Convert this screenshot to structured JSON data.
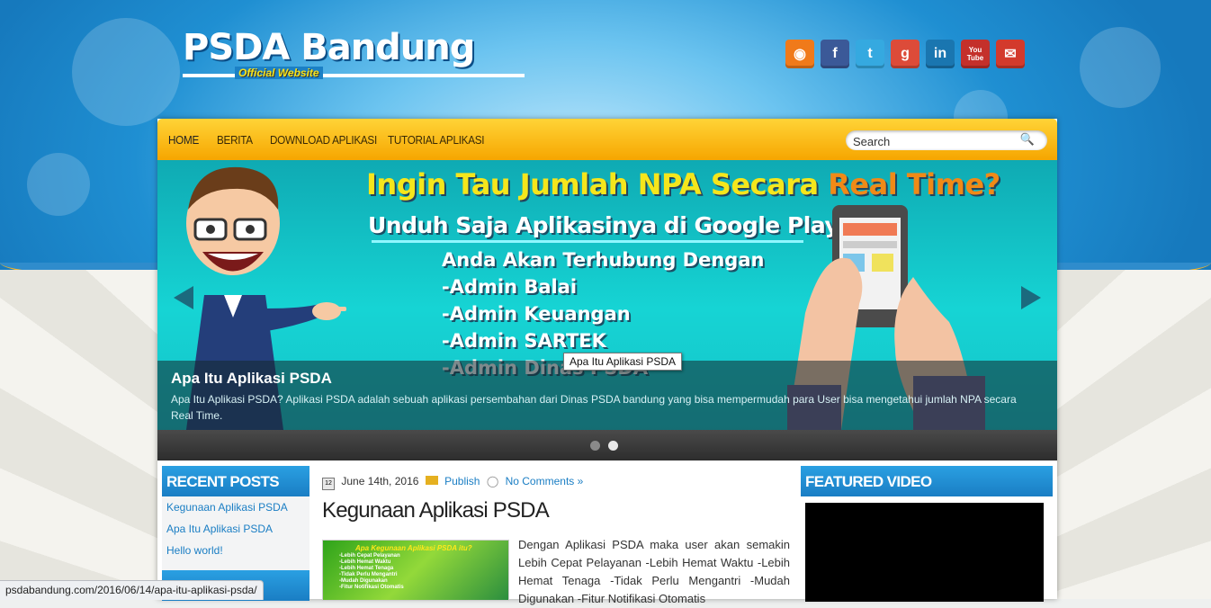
{
  "site": {
    "title": "PSDA Bandung",
    "subtitle": "Official Website"
  },
  "social": [
    {
      "name": "rss-icon",
      "glyph": "◉",
      "color": "#f07a1a"
    },
    {
      "name": "facebook-icon",
      "glyph": "f",
      "color": "#3b5998"
    },
    {
      "name": "twitter-icon",
      "glyph": "t",
      "color": "#35a9e0"
    },
    {
      "name": "google-icon",
      "glyph": "g",
      "color": "#dd4b39"
    },
    {
      "name": "linkedin-icon",
      "glyph": "in",
      "color": "#1a76b0"
    },
    {
      "name": "youtube-icon",
      "glyph": "You Tube",
      "color": "#c4302b"
    },
    {
      "name": "email-icon",
      "glyph": "✉",
      "color": "#d33a2c"
    }
  ],
  "nav": {
    "items": [
      "HOME",
      "BERITA",
      "DOWNLOAD APLIKASI",
      "TUTORIAL APLIKASI"
    ],
    "search_value": "Search"
  },
  "slider": {
    "headline_part1": "Ingin Tau Jumlah NPA Secara ",
    "headline_part2": "Real Time?",
    "subhead": "Unduh Saja Aplikasinya di Google Play",
    "list": [
      "Anda Akan Terhubung Dengan",
      "-Admin Balai",
      "-Admin Keuangan",
      "-Admin SARTEK",
      "-Admin Dinas PSDA"
    ],
    "caption_title": "Apa Itu Aplikasi PSDA",
    "caption_text": "Apa Itu Aplikasi PSDA? Aplikasi PSDA adalah sebuah aplikasi persembahan dari Dinas PSDA bandung yang bisa mempermudah para User bisa mengetahui jumlah NPA secara Real Time.",
    "tooltip": "Apa Itu Aplikasi PSDA",
    "active_dot": 2,
    "dot_count": 2
  },
  "recent_posts": {
    "title": "RECENT POSTS",
    "items": [
      "Kegunaan Aplikasi PSDA",
      "Apa Itu Aplikasi PSDA",
      "Hello world!"
    ]
  },
  "post": {
    "date": "June 14th, 2016",
    "category": "Publish",
    "comments": "No Comments »",
    "title": "Kegunaan Aplikasi PSDA",
    "thumb_title": "Apa Kegunaan Aplikasi PSDA itu?",
    "thumb_items": [
      "-Lebih Cepat Pelayanan",
      "-Lebih Hemat Waktu",
      "-Lebih Hemat Tenaga",
      "-Tidak Perlu Mengantri",
      "-Mudah Digunakan",
      "-Fitur Notifikasi Otomatis"
    ],
    "excerpt": "Dengan Aplikasi PSDA maka user akan semakin Lebih Cepat Pelayanan -Lebih Hemat Waktu -Lebih Hemat Tenaga -Tidak Perlu Mengantri -Mudah Digunakan -Fitur Notifikasi Otomatis"
  },
  "featured_video": {
    "title": "FEATURED VIDEO"
  },
  "status_url": "psdabandung.com/2016/06/14/apa-itu-aplikasi-psda/",
  "colors": {
    "nav_gradient_top": "#ffd437",
    "nav_gradient_bottom": "#f6a600",
    "widget_blue": "#1a7ec4",
    "link_blue": "#1a7ec4"
  }
}
